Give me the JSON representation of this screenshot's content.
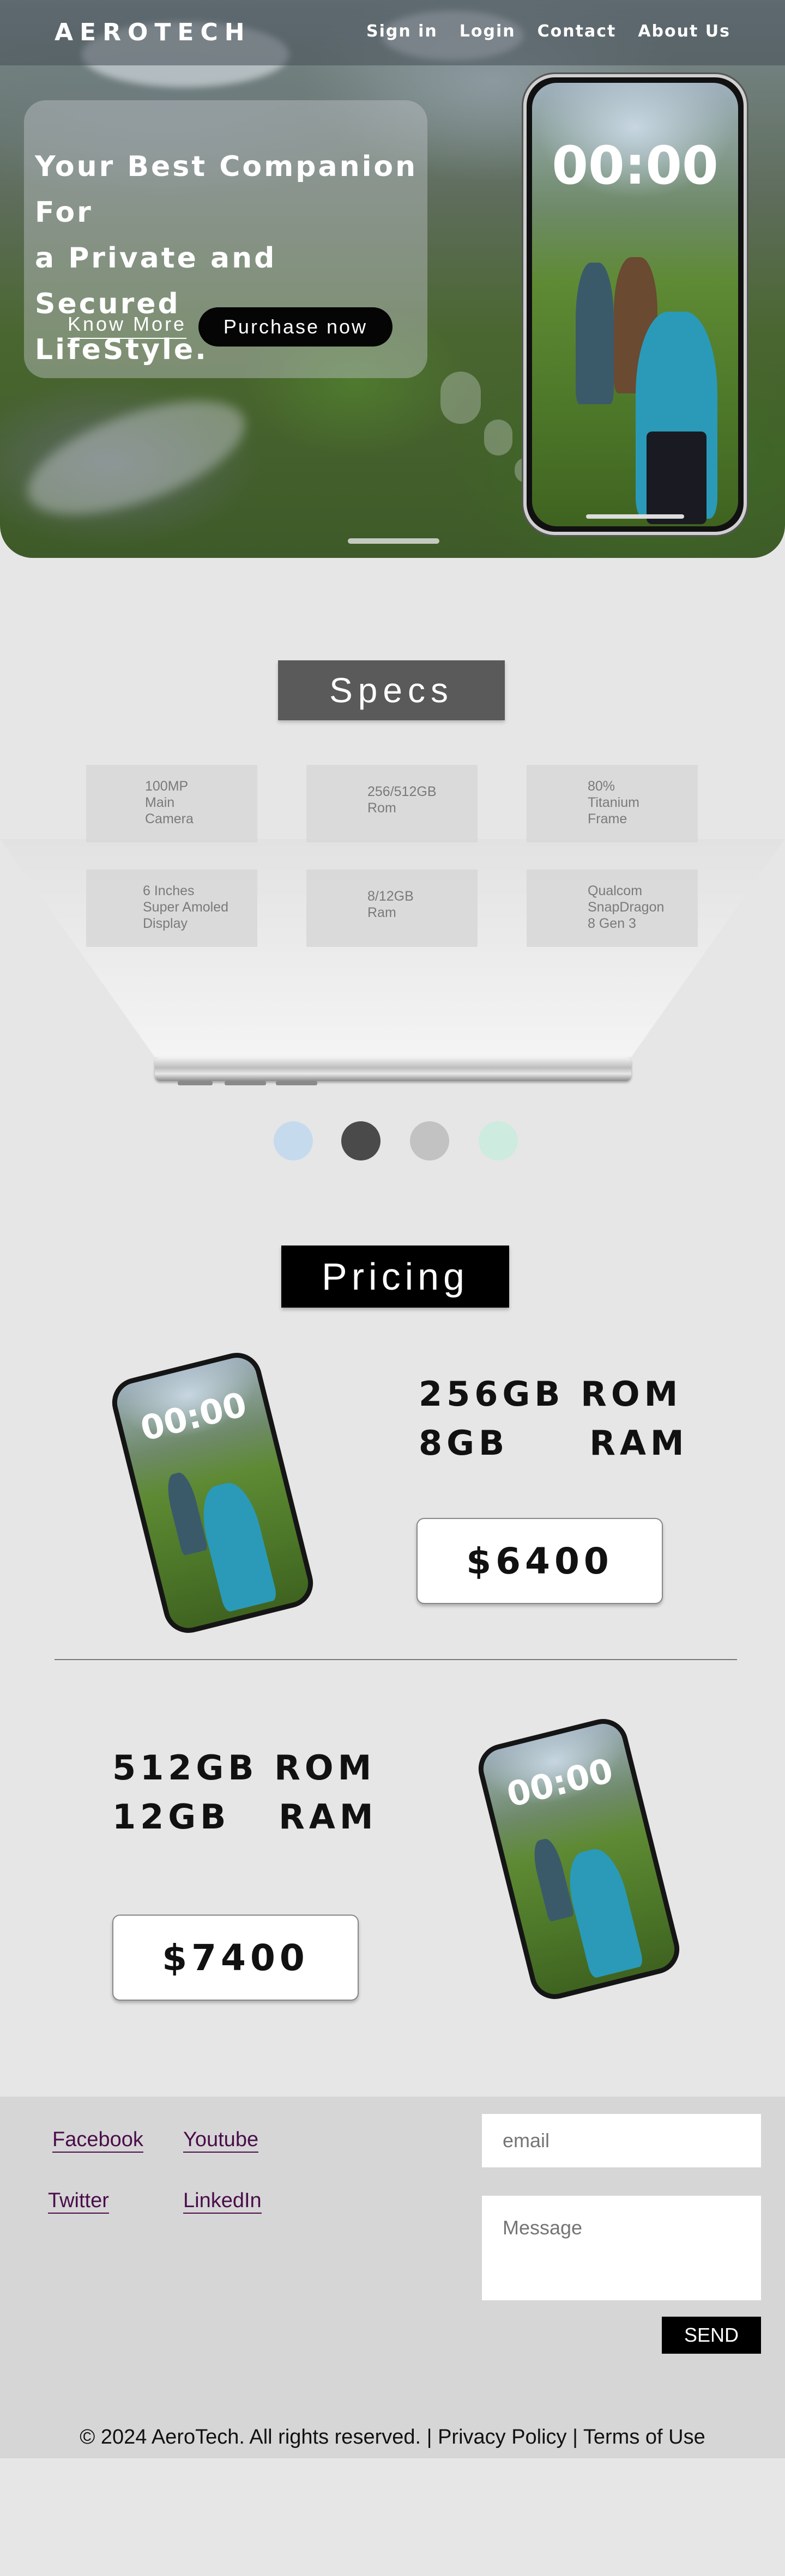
{
  "nav": {
    "logo": "AEROTECH",
    "links": [
      "Sign in",
      "Login",
      "Contact",
      "About Us"
    ]
  },
  "hero": {
    "headline_lines": [
      "Your Best Companion For",
      "a Private and Secured",
      "LifeStyle."
    ],
    "know_more": "Know More",
    "purchase": "Purchase now",
    "phone_clock": "00:00"
  },
  "specs": {
    "title": "Specs",
    "items": [
      "100MP\nMain\nCamera",
      "256/512GB\nRom",
      "80%\nTitanium\nFrame",
      "6 Inches\nSuper Amoled\nDisplay",
      "8/12GB\nRam",
      "Qualcom\nSnapDragon\n8 Gen 3"
    ],
    "colors": [
      "#c6daee",
      "#4a4a4a",
      "#c2c2c2",
      "#cdebdf"
    ]
  },
  "pricing": {
    "title": "Pricing",
    "plans": [
      {
        "spec": "256GB ROM\n8GB     RAM",
        "price": "$6400",
        "clock": "00:00"
      },
      {
        "spec": "512GB ROM\n12GB   RAM",
        "price": "$7400",
        "clock": "00:00"
      }
    ]
  },
  "footer": {
    "socials": [
      "Facebook",
      "Youtube",
      "Twitter",
      "LinkedIn"
    ],
    "email_placeholder": "email",
    "message_placeholder": "Message",
    "send": "SEND",
    "copyright": "© 2024 AeroTech. All rights reserved.",
    "separator": "|",
    "privacy": "Privacy Policy",
    "terms": "Terms of Use"
  }
}
